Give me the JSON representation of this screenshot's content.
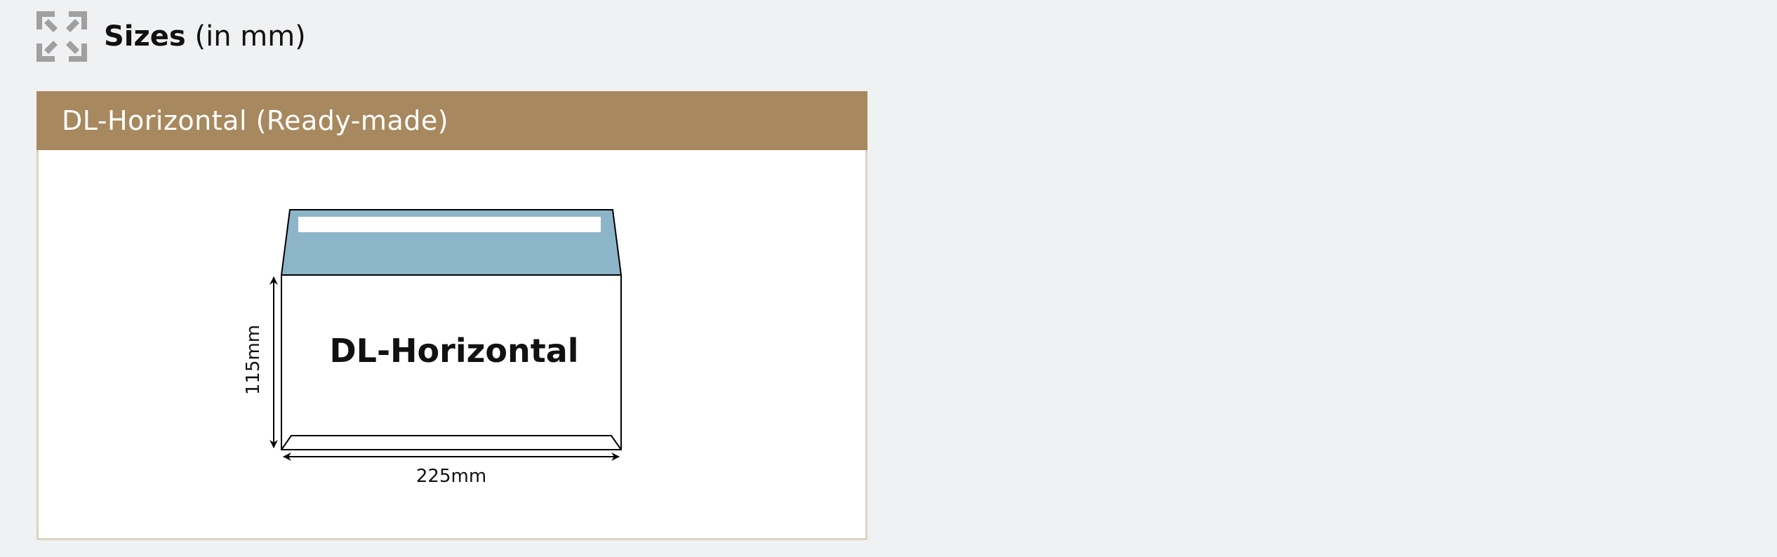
{
  "heading": {
    "icon": "expand-arrows-icon",
    "title_bold": "Sizes",
    "title_light": "(in mm)"
  },
  "card": {
    "title": "DL-Horizontal (Ready-made)",
    "header_color": "#a8885e",
    "border_color": "#ddd3c4"
  },
  "envelope": {
    "label": "DL-Horizontal",
    "height_label": "115mm",
    "width_label": "225mm",
    "flap_color": "#8db5c9"
  }
}
